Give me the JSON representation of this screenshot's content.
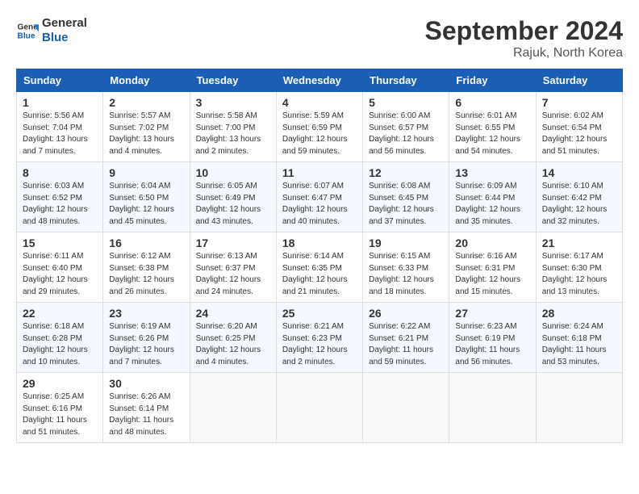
{
  "header": {
    "logo_line1": "General",
    "logo_line2": "Blue",
    "month": "September 2024",
    "location": "Rajuk, North Korea"
  },
  "columns": [
    "Sunday",
    "Monday",
    "Tuesday",
    "Wednesday",
    "Thursday",
    "Friday",
    "Saturday"
  ],
  "weeks": [
    [
      {
        "day": "1",
        "info": "Sunrise: 5:56 AM\nSunset: 7:04 PM\nDaylight: 13 hours\nand 7 minutes."
      },
      {
        "day": "2",
        "info": "Sunrise: 5:57 AM\nSunset: 7:02 PM\nDaylight: 13 hours\nand 4 minutes."
      },
      {
        "day": "3",
        "info": "Sunrise: 5:58 AM\nSunset: 7:00 PM\nDaylight: 13 hours\nand 2 minutes."
      },
      {
        "day": "4",
        "info": "Sunrise: 5:59 AM\nSunset: 6:59 PM\nDaylight: 12 hours\nand 59 minutes."
      },
      {
        "day": "5",
        "info": "Sunrise: 6:00 AM\nSunset: 6:57 PM\nDaylight: 12 hours\nand 56 minutes."
      },
      {
        "day": "6",
        "info": "Sunrise: 6:01 AM\nSunset: 6:55 PM\nDaylight: 12 hours\nand 54 minutes."
      },
      {
        "day": "7",
        "info": "Sunrise: 6:02 AM\nSunset: 6:54 PM\nDaylight: 12 hours\nand 51 minutes."
      }
    ],
    [
      {
        "day": "8",
        "info": "Sunrise: 6:03 AM\nSunset: 6:52 PM\nDaylight: 12 hours\nand 48 minutes."
      },
      {
        "day": "9",
        "info": "Sunrise: 6:04 AM\nSunset: 6:50 PM\nDaylight: 12 hours\nand 45 minutes."
      },
      {
        "day": "10",
        "info": "Sunrise: 6:05 AM\nSunset: 6:49 PM\nDaylight: 12 hours\nand 43 minutes."
      },
      {
        "day": "11",
        "info": "Sunrise: 6:07 AM\nSunset: 6:47 PM\nDaylight: 12 hours\nand 40 minutes."
      },
      {
        "day": "12",
        "info": "Sunrise: 6:08 AM\nSunset: 6:45 PM\nDaylight: 12 hours\nand 37 minutes."
      },
      {
        "day": "13",
        "info": "Sunrise: 6:09 AM\nSunset: 6:44 PM\nDaylight: 12 hours\nand 35 minutes."
      },
      {
        "day": "14",
        "info": "Sunrise: 6:10 AM\nSunset: 6:42 PM\nDaylight: 12 hours\nand 32 minutes."
      }
    ],
    [
      {
        "day": "15",
        "info": "Sunrise: 6:11 AM\nSunset: 6:40 PM\nDaylight: 12 hours\nand 29 minutes."
      },
      {
        "day": "16",
        "info": "Sunrise: 6:12 AM\nSunset: 6:38 PM\nDaylight: 12 hours\nand 26 minutes."
      },
      {
        "day": "17",
        "info": "Sunrise: 6:13 AM\nSunset: 6:37 PM\nDaylight: 12 hours\nand 24 minutes."
      },
      {
        "day": "18",
        "info": "Sunrise: 6:14 AM\nSunset: 6:35 PM\nDaylight: 12 hours\nand 21 minutes."
      },
      {
        "day": "19",
        "info": "Sunrise: 6:15 AM\nSunset: 6:33 PM\nDaylight: 12 hours\nand 18 minutes."
      },
      {
        "day": "20",
        "info": "Sunrise: 6:16 AM\nSunset: 6:31 PM\nDaylight: 12 hours\nand 15 minutes."
      },
      {
        "day": "21",
        "info": "Sunrise: 6:17 AM\nSunset: 6:30 PM\nDaylight: 12 hours\nand 13 minutes."
      }
    ],
    [
      {
        "day": "22",
        "info": "Sunrise: 6:18 AM\nSunset: 6:28 PM\nDaylight: 12 hours\nand 10 minutes."
      },
      {
        "day": "23",
        "info": "Sunrise: 6:19 AM\nSunset: 6:26 PM\nDaylight: 12 hours\nand 7 minutes."
      },
      {
        "day": "24",
        "info": "Sunrise: 6:20 AM\nSunset: 6:25 PM\nDaylight: 12 hours\nand 4 minutes."
      },
      {
        "day": "25",
        "info": "Sunrise: 6:21 AM\nSunset: 6:23 PM\nDaylight: 12 hours\nand 2 minutes."
      },
      {
        "day": "26",
        "info": "Sunrise: 6:22 AM\nSunset: 6:21 PM\nDaylight: 11 hours\nand 59 minutes."
      },
      {
        "day": "27",
        "info": "Sunrise: 6:23 AM\nSunset: 6:19 PM\nDaylight: 11 hours\nand 56 minutes."
      },
      {
        "day": "28",
        "info": "Sunrise: 6:24 AM\nSunset: 6:18 PM\nDaylight: 11 hours\nand 53 minutes."
      }
    ],
    [
      {
        "day": "29",
        "info": "Sunrise: 6:25 AM\nSunset: 6:16 PM\nDaylight: 11 hours\nand 51 minutes."
      },
      {
        "day": "30",
        "info": "Sunrise: 6:26 AM\nSunset: 6:14 PM\nDaylight: 11 hours\nand 48 minutes."
      },
      {
        "day": "",
        "info": ""
      },
      {
        "day": "",
        "info": ""
      },
      {
        "day": "",
        "info": ""
      },
      {
        "day": "",
        "info": ""
      },
      {
        "day": "",
        "info": ""
      }
    ]
  ]
}
